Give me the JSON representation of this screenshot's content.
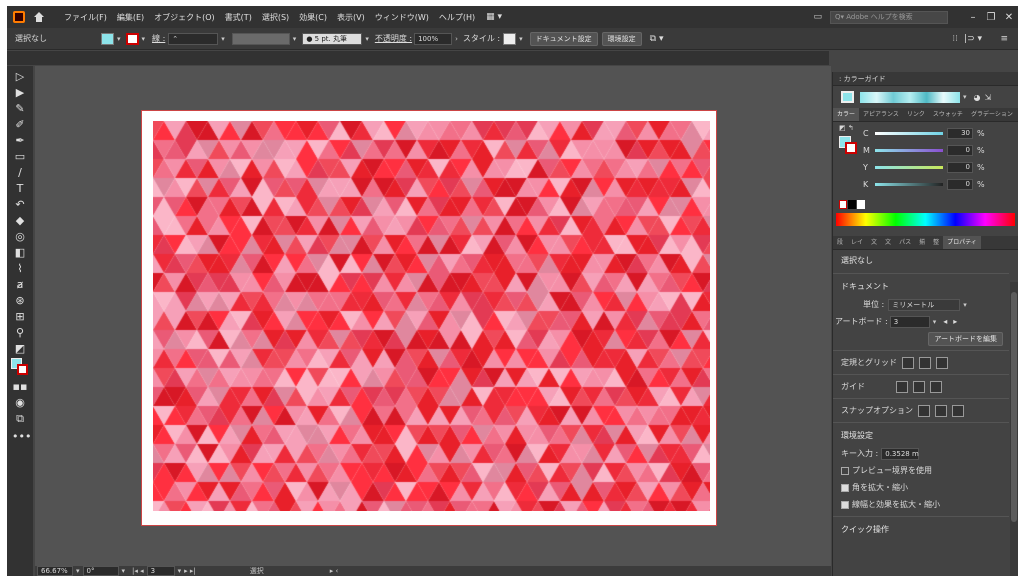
{
  "menubar": {
    "items": [
      "ファイル(F)",
      "編集(E)",
      "オブジェクト(O)",
      "書式(T)",
      "選択(S)",
      "効果(C)",
      "表示(V)",
      "ウィンドウ(W)",
      "ヘルプ(H)"
    ],
    "search_placeholder": "Q▾ Adobe ヘルプを検索"
  },
  "control": {
    "selection": "選択なし",
    "stroke_label": "線 :",
    "stroke_spin": "⌃",
    "brush": "● 5 pt. 丸筆",
    "opacity_label": "不透明度 :",
    "opacity": "100%",
    "style_label": "スタイル :",
    "doc_settings": "ドキュメント設定",
    "preferences": "環境設定"
  },
  "colorguide": {
    "title": "カラーガイド"
  },
  "color": {
    "tabs": [
      "カラー",
      "アピアランス",
      "リンク",
      "スウォッチ",
      "グラデーション"
    ],
    "channels": [
      {
        "name": "C",
        "value": "30",
        "unit": "%"
      },
      {
        "name": "M",
        "value": "0",
        "unit": "%"
      },
      {
        "name": "Y",
        "value": "0",
        "unit": "%"
      },
      {
        "name": "K",
        "value": "0",
        "unit": "%"
      }
    ]
  },
  "props": {
    "tabs": [
      "段",
      "レイ",
      "文",
      "文",
      "パス",
      "揃",
      "整",
      "プロパティ"
    ],
    "selection": "選択なし",
    "doc_heading": "ドキュメント",
    "units_label": "単位 :",
    "units": "ミリメートル",
    "artboard_label": "アートボード :",
    "artboard": "3",
    "edit_artboards": "アートボードを編集",
    "rulers_grid": "定規とグリッド",
    "guides": "ガイド",
    "snap": "スナップオプション",
    "prefs_heading": "環境設定",
    "key_label": "キー入力 :",
    "key_value": "0.3528 m",
    "cb_preview": "プレビュー境界を使用",
    "cb_corners": "角を拡大・縮小",
    "cb_strokes": "線幅と効果を拡大・縮小",
    "bottom": "クイック操作"
  },
  "status": {
    "zoom": "66.67%",
    "angle": "0°",
    "artboard": "3",
    "tool": "選択"
  },
  "colors": {
    "fill": "#8de4ea",
    "c_slider": "#6fd3e6",
    "pattern_base": "#e8202a"
  }
}
